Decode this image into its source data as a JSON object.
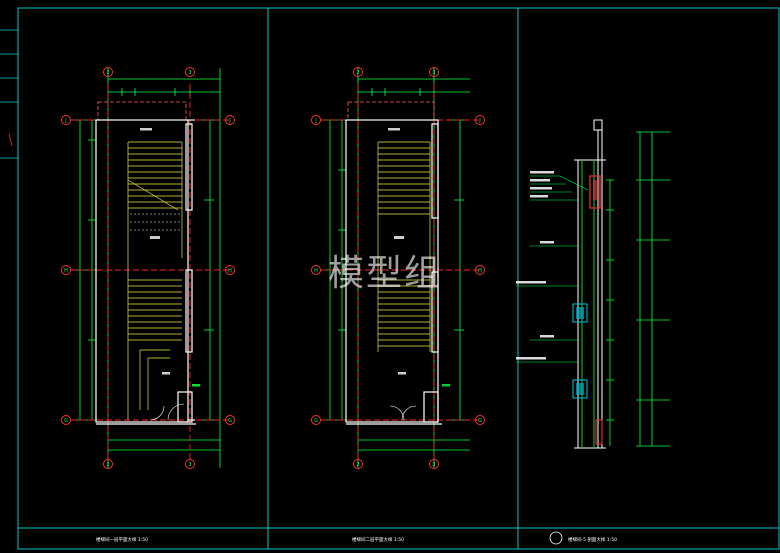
{
  "watermark": "模型组",
  "title_block": {
    "titles": [
      "楼梯间一层平面大样 1:50",
      "楼梯间二层平面大样 1:50",
      "楼梯间-5 剖面大样 1:50"
    ]
  },
  "grid_labels": {
    "columns": [
      "2",
      "3"
    ],
    "rows": [
      "J",
      "H",
      "G"
    ]
  },
  "colors": {
    "background": "#000000",
    "frame": "#00c8c8",
    "grid_axis": "#ff2020",
    "dimension": "#00ff40",
    "wall": "#ffffff",
    "stair": "#e8e840",
    "label_ring": "#ff3030",
    "section_fill": "#00b0c0"
  }
}
